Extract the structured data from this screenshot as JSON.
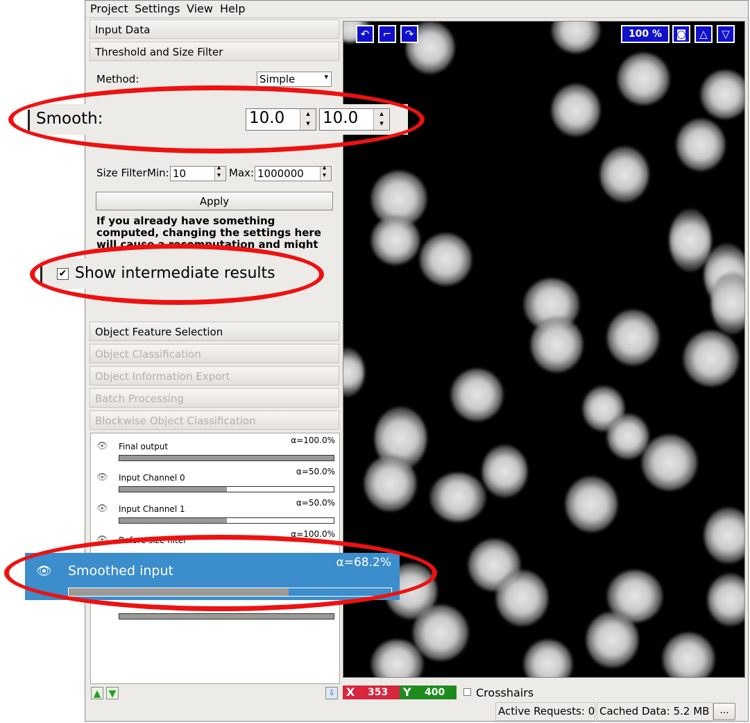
{
  "menu": {
    "project": "Project",
    "settings": "Settings",
    "view": "View",
    "help": "Help"
  },
  "applets": {
    "input_data": "Input Data",
    "threshold": "Threshold and Size Filter",
    "feature_selection": "Object Feature Selection",
    "classification": "Object Classification",
    "export": "Object Information Export",
    "batch": "Batch Processing",
    "blockwise": "Blockwise Object Classification"
  },
  "threshold": {
    "method_label": "Method:",
    "method_value": "Simple",
    "smooth_label": "Smooth:",
    "smooth_x": "10.0",
    "smooth_y": "10.0",
    "size_filter_label": "Size Filter",
    "min_label": "Min:",
    "min_value": "10",
    "max_label": "Max:",
    "max_value": "1000000",
    "apply_label": "Apply",
    "warning": "If you already have something computed, changing the settings here will cause a recomputation and might take a while.",
    "show_intermediate": "Show intermediate results"
  },
  "layers": [
    {
      "name": "Final output",
      "alpha": "α=100.0%",
      "opacity": 1.0
    },
    {
      "name": "Input Channel 0",
      "alpha": "α=50.0%",
      "opacity": 0.5
    },
    {
      "name": "Input Channel 1",
      "alpha": "α=50.0%",
      "opacity": 0.5
    },
    {
      "name": "Before size filter",
      "alpha": "α=100.0%",
      "opacity": 1.0
    }
  ],
  "selected_layer": {
    "name": "Smoothed input",
    "alpha": "α=68.2%",
    "opacity": 0.682
  },
  "viewer": {
    "zoom": "100 %"
  },
  "coords": {
    "x_label": "X",
    "x_value": "353",
    "y_label": "Y",
    "y_value": "400"
  },
  "crosshairs_label": "Crosshairs",
  "status": {
    "active_requests": "Active Requests: 0",
    "cached_data": "Cached Data: 5.2 MB",
    "more": "..."
  },
  "colors": {
    "highlight": "#ee1111",
    "selected_layer_bg": "#3b8dcb",
    "x_bg": "#d7263d",
    "y_bg": "#1e8b1e",
    "viewer_btn": "#1111cc"
  }
}
